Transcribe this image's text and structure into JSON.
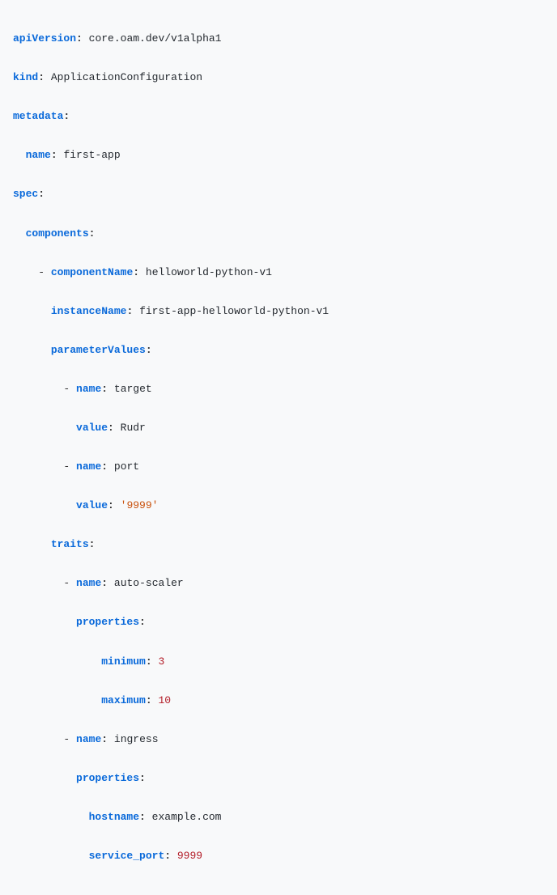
{
  "yaml": {
    "apiVersion": {
      "key": "apiVersion",
      "value": "core.oam.dev/v1alpha1"
    },
    "kind": {
      "key": "kind",
      "value": "ApplicationConfiguration"
    },
    "metadata": {
      "key": "metadata",
      "name": {
        "key": "name",
        "value": "first-app"
      }
    },
    "spec": {
      "key": "spec",
      "components": {
        "key": "components",
        "item0": {
          "componentName": {
            "key": "componentName",
            "value": "helloworld-python-v1"
          },
          "instanceName": {
            "key": "instanceName",
            "value": "first-app-helloworld-python-v1"
          },
          "parameterValues": {
            "key": "parameterValues",
            "item0": {
              "name": {
                "key": "name",
                "value": "target"
              },
              "value": {
                "key": "value",
                "val": "Rudr"
              }
            },
            "item1": {
              "name": {
                "key": "name",
                "value": "port"
              },
              "value": {
                "key": "value",
                "val": "'9999'"
              }
            }
          },
          "traits": {
            "key": "traits",
            "item0": {
              "name": {
                "key": "name",
                "value": "auto-scaler"
              },
              "properties": {
                "key": "properties",
                "minimum": {
                  "key": "minimum",
                  "value": "3"
                },
                "maximum": {
                  "key": "maximum",
                  "value": "10"
                }
              }
            },
            "item1": {
              "name": {
                "key": "name",
                "value": "ingress"
              },
              "properties": {
                "key": "properties",
                "hostname": {
                  "key": "hostname",
                  "value": "example.com"
                },
                "service_port": {
                  "key": "service_port",
                  "value": "9999"
                }
              }
            }
          }
        }
      }
    }
  }
}
